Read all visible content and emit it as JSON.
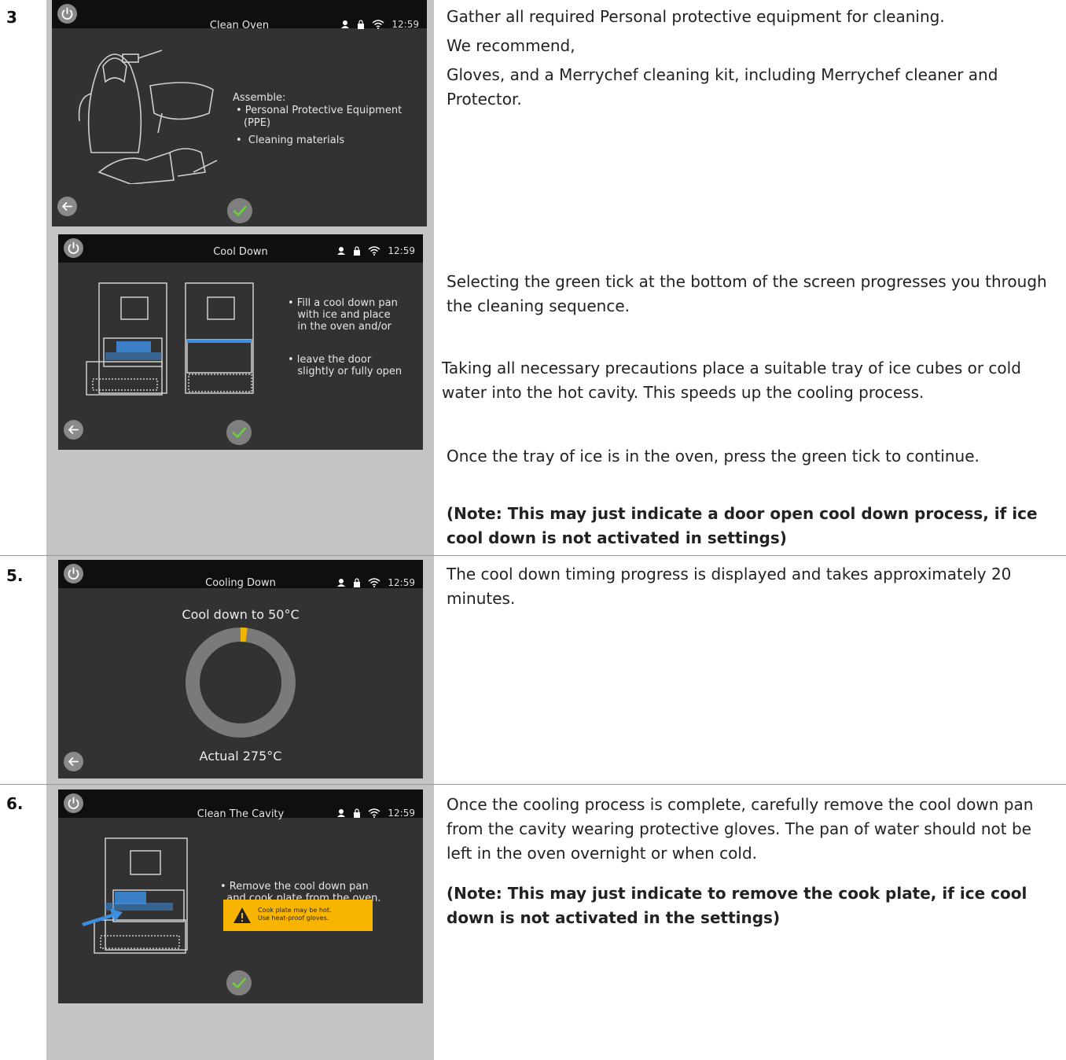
{
  "steps": {
    "s3": {
      "number": "3",
      "screen1": {
        "title": "Clean Oven",
        "time": "12:59",
        "heading": "Assemble:",
        "line1": "• Personal Protective Equipment",
        "line2": "(PPE)",
        "line3": "•  Cleaning materials"
      },
      "screen2": {
        "title": "Cool Down",
        "time": "12:59",
        "text1": "• Fill a cool down pan\n   with ice and place\n   in the oven and/or",
        "text2": "• leave the door\n   slightly or fully open"
      },
      "desc1": "Gather all required Personal protective equipment for cleaning.",
      "desc2": "We recommend,",
      "desc3": "Gloves, and a Merrychef cleaning kit, including Merrychef cleaner and Protector.",
      "desc4": "Selecting the green tick at the bottom of the screen progresses you through the cleaning sequence.",
      "desc5": "Taking all necessary precautions place a suitable tray of ice cubes or cold water into the hot cavity. This speeds up the cooling process.",
      "desc6": "Once the tray of ice is in the oven, press the green tick to continue.",
      "note": "(Note: This may just indicate a door open cool down process, if ice cool down is not activated in settings)"
    },
    "s5": {
      "number": "5.",
      "screen": {
        "title": "Cooling Down",
        "time": "12:59",
        "target": "Cool down to 50°C",
        "actual": "Actual 275°C",
        "progress": 0.02
      },
      "desc": "The cool down timing progress is displayed and takes approximately 20 minutes."
    },
    "s6": {
      "number": "6.",
      "screen": {
        "title": "Clean The Cavity",
        "time": "12:59",
        "text": "• Remove the cool down pan\n  and cook plate from the oven.",
        "warning1": "Cook plate may be hot.",
        "warning2": "Use heat-proof gloves."
      },
      "desc": "Once the cooling process is complete, carefully remove the cool down pan from the cavity wearing protective gloves. The pan of water should not be left in the oven overnight or when cold.",
      "note": "(Note: This may just indicate to remove the cook plate, if ice cool down is not activated in the settings)"
    }
  },
  "colors": {
    "tick": "#6bd13a",
    "progress_ring": "#7a7a7a",
    "progress_fill": "#f2b400",
    "warning": "#f7b500",
    "blue": "#3d8ee0"
  },
  "icons": [
    "power-icon",
    "user-icon",
    "lock-icon",
    "wifi-icon",
    "back-arrow-icon",
    "check-icon",
    "warning-icon"
  ]
}
